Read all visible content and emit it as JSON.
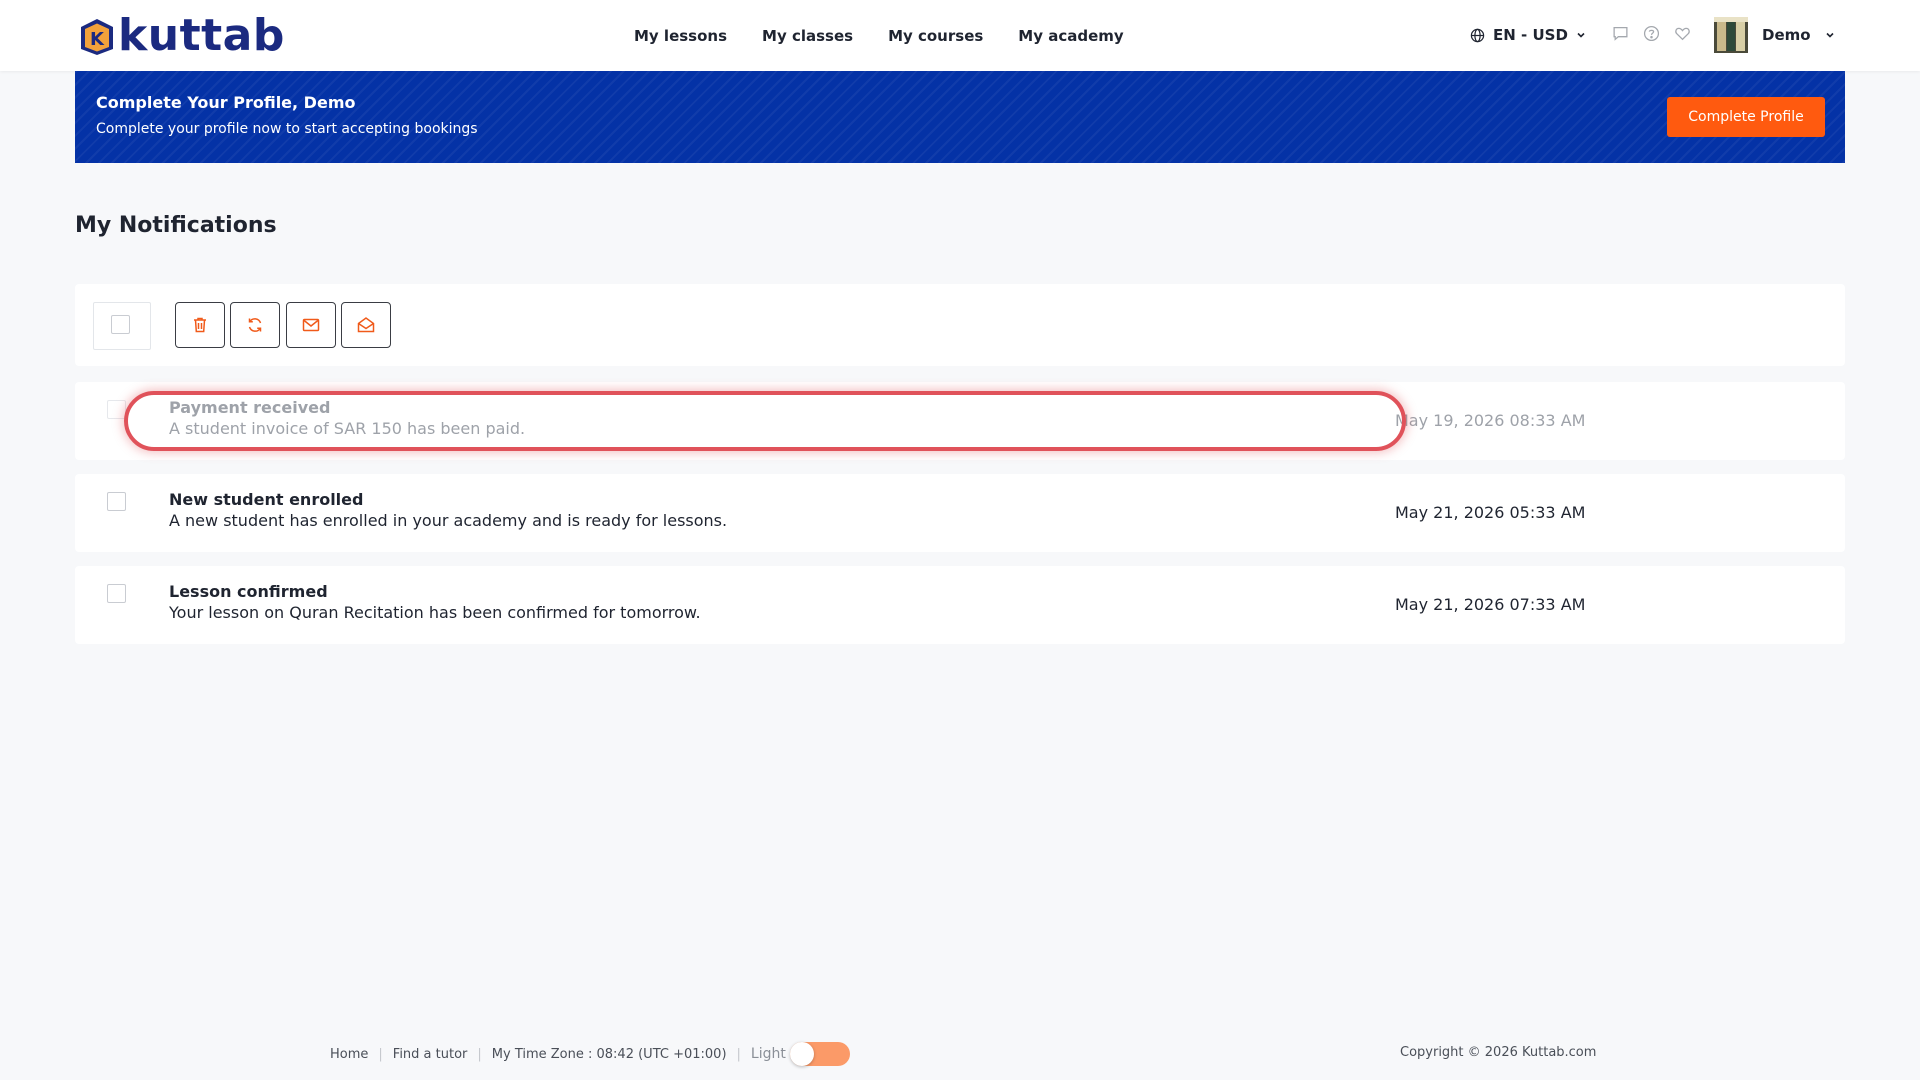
{
  "brand": {
    "name": "kuttab",
    "logo_letter": "K"
  },
  "nav": {
    "items": [
      {
        "label": "My lessons"
      },
      {
        "label": "My classes"
      },
      {
        "label": "My courses"
      },
      {
        "label": "My academy"
      }
    ]
  },
  "header": {
    "language_currency": "EN - USD",
    "icons": [
      "globe-icon",
      "chat-icon",
      "help-icon",
      "heart-icon",
      "chevron-down-icon"
    ],
    "user_name": "Demo"
  },
  "banner": {
    "title": "Complete Your Profile, Demo",
    "subtitle": "Complete your profile now to start accepting bookings",
    "button_label": "Complete Profile"
  },
  "page": {
    "title": "My Notifications"
  },
  "toolbar": {
    "actions": [
      "trash-icon",
      "refresh-icon",
      "mail-closed-icon",
      "mail-open-icon"
    ]
  },
  "notifications": [
    {
      "title": "Payment received",
      "body": "A student invoice of SAR 150 has been paid.",
      "date": "May 19, 2026 08:33 AM",
      "read": true
    },
    {
      "title": "New student enrolled",
      "body": "A new student has enrolled in your academy and is ready for lessons.",
      "date": "May 21, 2026 05:33 AM",
      "read": false
    },
    {
      "title": "Lesson confirmed",
      "body": "Your lesson on Quran Recitation has been confirmed for tomorrow.",
      "date": "May 21, 2026 07:33 AM",
      "read": false
    }
  ],
  "footer": {
    "links": [
      "Home",
      "Find a tutor"
    ],
    "timezone": "My Time Zone : 08:42 (UTC +01:00)",
    "theme_label": "Light",
    "copyright": "Copyright © 2026 Kuttab.com"
  },
  "colors": {
    "brand_navy": "#1b2a80",
    "banner_blue": "#0432a6",
    "accent_orange": "#ff5a0f",
    "highlight_red": "#e0525a"
  }
}
